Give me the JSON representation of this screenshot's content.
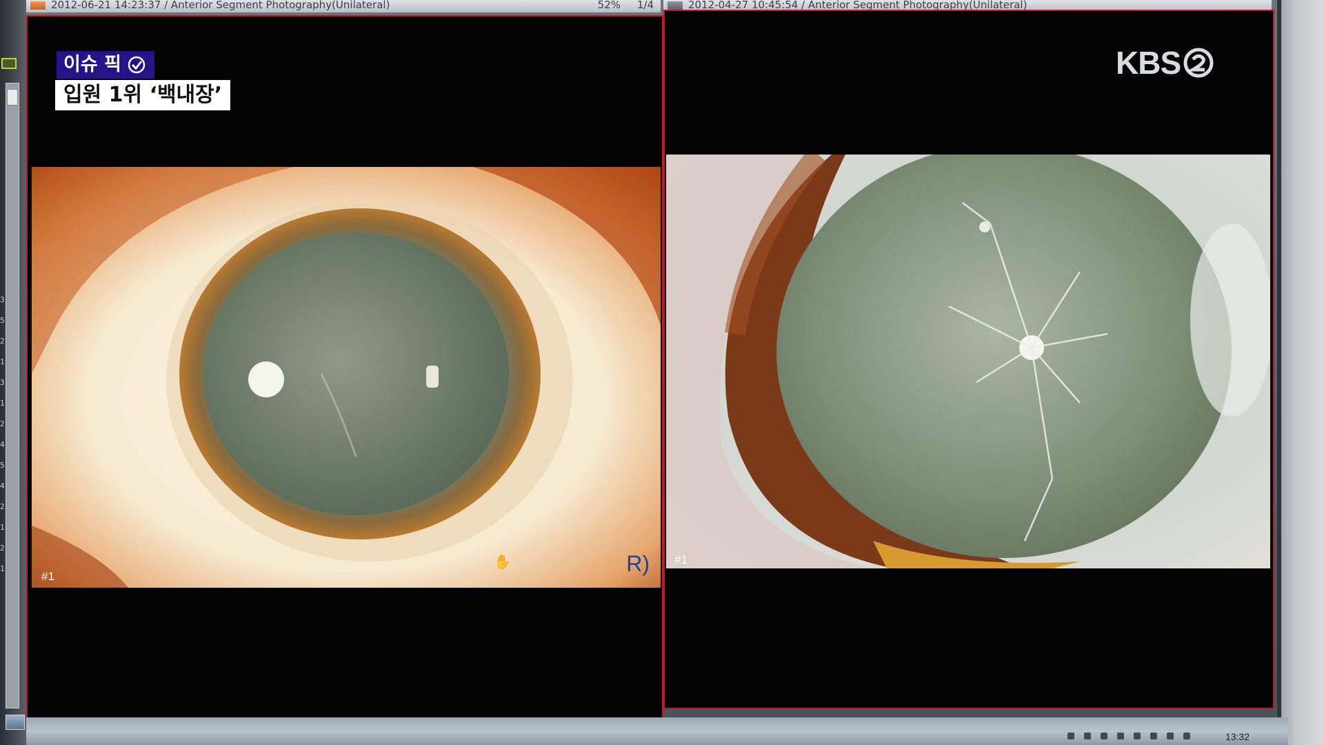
{
  "header_left": {
    "title": "2012-06-21 14:23:37 / Anterior Segment Photography(Unilateral)",
    "zoom": "52%",
    "page": "1/4"
  },
  "header_right": {
    "title": "2012-04-27 10:45:54 / Anterior Segment Photography(Unilateral)"
  },
  "left_image": {
    "label": "#1",
    "eye_tag": "R)"
  },
  "right_image": {
    "label": "#1"
  },
  "side_marks": [
    "3",
    "5",
    "2",
    "1",
    "3",
    "1",
    "2",
    "4",
    "5",
    "4",
    "2",
    "1",
    "2",
    "1"
  ],
  "overlay": {
    "badge": "이슈 픽",
    "headline": "입원 1위 ‘백내장’",
    "logo": "KBS"
  },
  "taskbar": {
    "clock": "13:32"
  },
  "colors": {
    "panel_border": "#c21a24",
    "badge_bg": "#26138a",
    "eye_tag": "#1d3fa0"
  },
  "icons": [
    "check-circle-icon",
    "hand-cursor-icon",
    "kbs2-logo-icon"
  ]
}
